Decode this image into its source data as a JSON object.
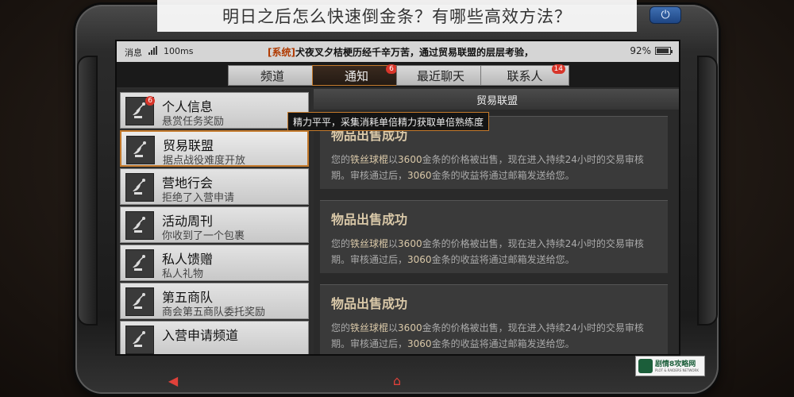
{
  "caption": "明日之后怎么快速倒金条？有哪些高效方法？",
  "status_bar": {
    "left_label": "消息",
    "ping": "100ms",
    "marquee_tag": "[系统]",
    "marquee_text": "犬夜叉夕桔梗历经千辛万苦，通过贸易联盟的层层考验，",
    "battery": "92%"
  },
  "tabs": [
    {
      "label": "频道",
      "badge": ""
    },
    {
      "label": "通知",
      "badge": "6"
    },
    {
      "label": "最近聊天",
      "badge": ""
    },
    {
      "label": "联系人",
      "badge": "14"
    }
  ],
  "sidebar": {
    "items": [
      {
        "title": "个人信息",
        "subtitle": "悬赏任务奖励",
        "badge": "6"
      },
      {
        "title": "贸易联盟",
        "subtitle": "据点战役难度开放",
        "badge": ""
      },
      {
        "title": "营地行会",
        "subtitle": "拒绝了入营申请",
        "badge": ""
      },
      {
        "title": "活动周刊",
        "subtitle": "你收到了一个包裹",
        "badge": ""
      },
      {
        "title": "私人馈赠",
        "subtitle": "私人礼物",
        "badge": ""
      },
      {
        "title": "第五商队",
        "subtitle": "商会第五商队委托奖励",
        "badge": ""
      },
      {
        "title": "入营申请频道",
        "subtitle": "",
        "badge": ""
      }
    ]
  },
  "tooltip": "精力平平，采集消耗单倍精力获取单倍熟练度",
  "panel": {
    "title": "贸易联盟",
    "messages": [
      {
        "title": "物品出售成功",
        "p1": "您的",
        "item": "铁丝球棍",
        "p2": "以",
        "price": "3600",
        "p3": "金条的价格被出售，现在进入持续24小时的交易审核期。审核通过后，",
        "income": "3060",
        "p4": "金条的收益将通过邮箱发送给您。"
      },
      {
        "title": "物品出售成功",
        "p1": "您的",
        "item": "铁丝球棍",
        "p2": "以",
        "price": "3600",
        "p3": "金条的价格被出售，现在进入持续24小时的交易审核期。审核通过后，",
        "income": "3060",
        "p4": "金条的收益将通过邮箱发送给您。"
      },
      {
        "title": "物品出售成功",
        "p1": "您的",
        "item": "铁丝球棍",
        "p2": "以",
        "price": "3600",
        "p3": "金条的价格被出售，现在进入持续24小时的交易审核期。审核通过后，",
        "income": "3060",
        "p4": "金条的收益将通过邮箱发送给您。"
      }
    ]
  },
  "logo": {
    "name": "剧情8攻略网",
    "sub": "PLOT & RAIDERS NETWORK"
  },
  "colors": {
    "accent": "#c47a2c",
    "badge": "#d8352a",
    "nav": "#e0413a"
  }
}
